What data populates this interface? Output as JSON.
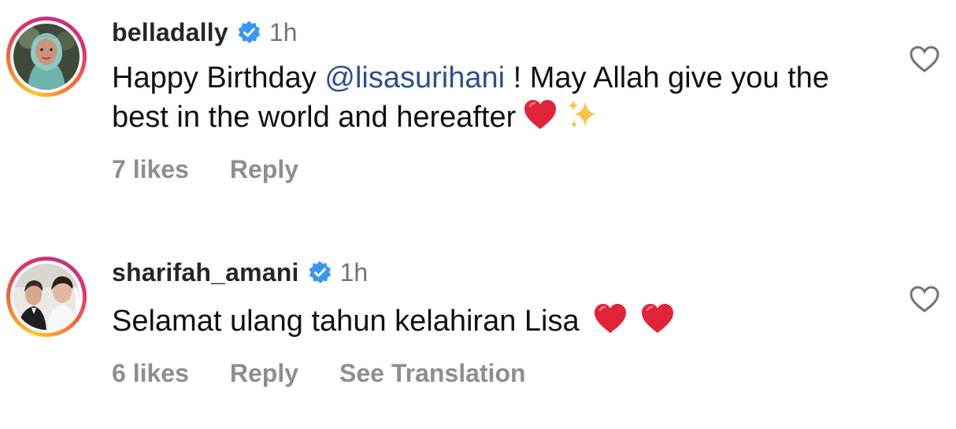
{
  "comments": [
    {
      "username": "belladally",
      "verified": true,
      "time": "1h",
      "text_before": "Happy Birthday ",
      "mention": "@lisasurihani",
      "text_after": " ! May Allah give you the best in the world and hereafter",
      "emojis": [
        "red-heart-emoji",
        "sparkles-emoji"
      ],
      "likes": "7 likes",
      "reply_label": "Reply",
      "like_icon": "heart-outline-icon"
    },
    {
      "username": "sharifah_amani",
      "verified": true,
      "time": "1h",
      "text": "Selamat ulang tahun kelahiran Lisa",
      "emojis": [
        "red-heart-emoji",
        "red-heart-emoji"
      ],
      "likes": "6 likes",
      "reply_label": "Reply",
      "translation_label": "See Translation",
      "like_icon": "heart-outline-icon"
    }
  ],
  "colors": {
    "username": "#262626",
    "time": "#737373",
    "action": "#8e8e8e",
    "mention": "#2d4f8e",
    "verified": "#3897f0",
    "heart_emoji": "#e0243a"
  }
}
